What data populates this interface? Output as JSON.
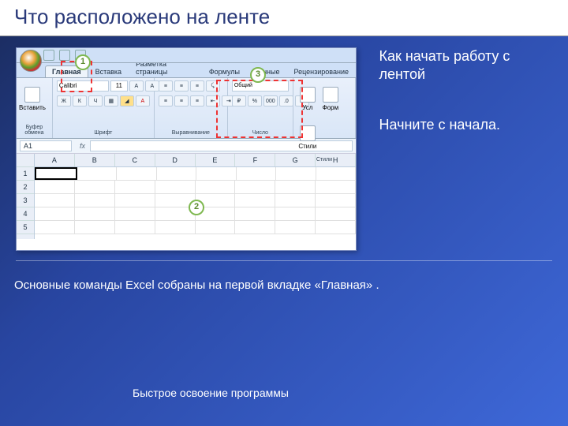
{
  "title": "Что расположено на ленте",
  "right": {
    "t1": "Как начать работу с лентой",
    "t2": "Начните с начала."
  },
  "body": "Основные команды Excel собраны на первой вкладке «Главная» .",
  "footer": "Быстрое освоение программы",
  "callouts": {
    "c1": "1",
    "c2": "2",
    "c3": "3"
  },
  "excel": {
    "tabs": [
      "Главная",
      "Вставка",
      "Разметка страницы",
      "Формулы",
      "Данные",
      "Рецензирование"
    ],
    "active_tab": 0,
    "groups": {
      "clipboard": {
        "label": "Буфер обмена",
        "paste": "Вставить"
      },
      "font": {
        "label": "Шрифт",
        "name": "Calibri",
        "size": "11",
        "bold": "Ж",
        "italic": "К",
        "underline": "Ч"
      },
      "alignment": {
        "label": "Выравнивание"
      },
      "number": {
        "label": "Число",
        "format": "Общий",
        "pct": "%",
        "comma": "000"
      },
      "styles": {
        "label": "Стили",
        "cond": "Усл",
        "fmt": "Форм",
        "cell": "Стили"
      }
    },
    "namebox": "A1",
    "fx": "fx",
    "cols": [
      "A",
      "B",
      "C",
      "D",
      "E",
      "F",
      "G",
      "H"
    ],
    "rows": [
      "1",
      "2",
      "3",
      "4",
      "5"
    ]
  }
}
